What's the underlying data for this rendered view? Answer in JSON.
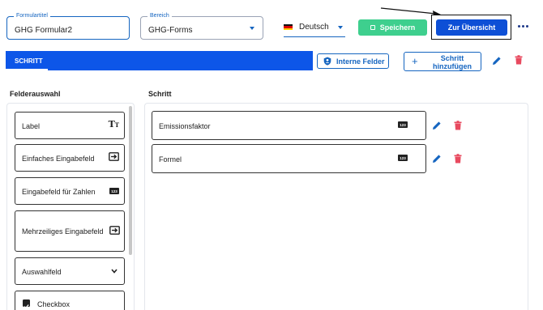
{
  "header": {
    "form_title": {
      "label": "Formulartitel",
      "value": "GHG Formular2"
    },
    "area": {
      "label": "Bereich",
      "value": "GHG-Forms"
    },
    "language": {
      "value": "Deutsch"
    },
    "save_label": "Speichern",
    "overview_label": "Zur Übersicht",
    "more_icon": "more-horizontal-icon"
  },
  "tabs": {
    "active_label": "SCHRITT"
  },
  "step_toolbar": {
    "internal_fields_label": "Interne Felder",
    "add_step_label": "Schritt hinzufügen"
  },
  "field_selection": {
    "title": "Felderauswahl",
    "items": [
      {
        "label": "Label",
        "icon": "text-size-icon"
      },
      {
        "label": "Einfaches Eingabefeld",
        "icon": "input-arrow-icon"
      },
      {
        "label": "Eingabefeld für Zahlen",
        "icon": "number-123-icon"
      },
      {
        "label": "Mehrzeiliges Eingabefeld",
        "icon": "input-arrow-icon"
      },
      {
        "label": "Auswahlfeld",
        "icon": "chevron-down-icon"
      },
      {
        "label": "Checkbox",
        "icon": "checkbox-icon"
      }
    ]
  },
  "step": {
    "title": "Schritt",
    "fields": [
      {
        "label": "Emissionsfaktor",
        "badge": "123"
      },
      {
        "label": "Formel",
        "badge": "123"
      }
    ]
  },
  "colors": {
    "primary": "#0d56e8",
    "primary_dark": "#0d4fd6",
    "accent_blue": "#1565c0",
    "save_green": "#3ecf8e",
    "delete_red": "#e84a5f"
  }
}
